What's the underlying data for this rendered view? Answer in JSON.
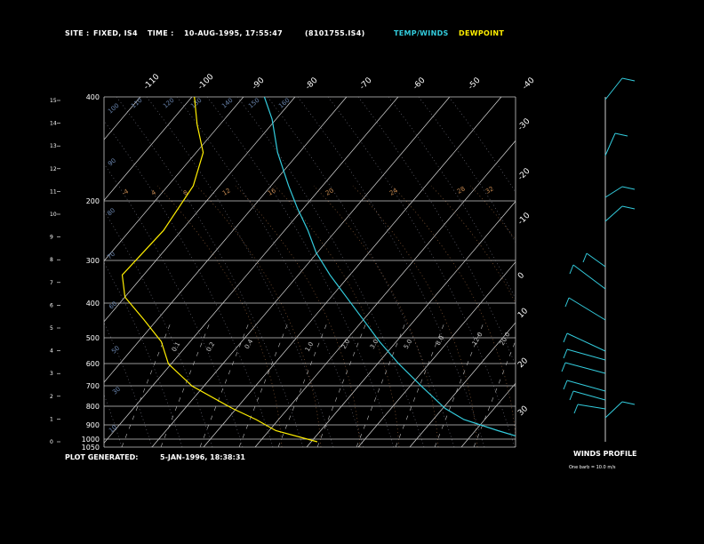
{
  "header": {
    "site_label": "SITE :",
    "site_value": "FIXED, IS4",
    "time_label": "TIME :",
    "time_value": "10-AUG-1995, 17:55:47",
    "file_name": "(8101755.IS4)",
    "temp_winds_label": "TEMP/WINDS",
    "dewpoint_label": "DEWPOINT",
    "colors": {
      "temp": "#33ccdd",
      "dewpoint": "#ffee00"
    }
  },
  "footer": {
    "generated_label": "PLOT GENERATED:",
    "generated_value": "5-JAN-1996, 18:38:31",
    "winds_profile_label": "WINDS PROFILE",
    "barb_note": "One barb = 10.0 m/s"
  },
  "chart_data": {
    "type": "line",
    "chart_kind": "skew-T log-P diagram",
    "x_axis": "temperature (C), skewed",
    "y_axis": "pressure (mb), log scale",
    "pressure_levels": [
      400,
      200,
      300,
      400,
      500,
      600,
      700,
      800,
      900,
      1000,
      1050
    ],
    "pressure_labels": [
      "400",
      "200",
      "300",
      "400",
      "500",
      "600",
      "700",
      "800",
      "900",
      "1000",
      "1050"
    ],
    "height_ticks": [
      "15",
      "14",
      "13",
      "12",
      "11",
      "10",
      "9",
      "8",
      "7",
      "6",
      "5",
      "4",
      "3",
      "2",
      "1",
      "0"
    ],
    "isotherm_top_labels": [
      "-110",
      "-100",
      "-90",
      "-80",
      "-70",
      "-60",
      "-50",
      "-40"
    ],
    "isotherm_right_labels": [
      "-30",
      "-20",
      "-10",
      "0",
      "10",
      "20",
      "30"
    ],
    "dry_adiabat_labels": [
      "10",
      "30",
      "50",
      "60",
      "70",
      "80",
      "90",
      "100",
      "110",
      "120",
      "130",
      "140",
      "150",
      "160"
    ],
    "mixing_ratio_labels": [
      "0.1",
      "0.2",
      "0.4",
      "1.0",
      "2.0",
      "3.0",
      "5.0",
      "8.0",
      "12.0",
      "20.0"
    ],
    "moist_adiabat_labels": [
      "-4",
      "4",
      "8",
      "12",
      "16",
      "20",
      "24",
      "28",
      "32"
    ],
    "series": [
      {
        "name": "TEMP/WINDS",
        "color": "#33ccdd",
        "points": [
          [
            400,
            -80.9
          ],
          [
            440,
            -79.5
          ],
          [
            500,
            -78.5
          ],
          [
            560,
            -76.5
          ],
          [
            600,
            -74.9
          ],
          [
            640,
            -73.0
          ],
          [
            680,
            -71.5
          ],
          [
            720,
            -69.0
          ],
          [
            760,
            -66.0
          ],
          [
            800,
            -63.0
          ],
          [
            840,
            -60.0
          ],
          [
            880,
            -56.5
          ],
          [
            920,
            -52.4
          ],
          [
            960,
            -48.1
          ],
          [
            980,
            -44.7
          ],
          [
            1000,
            -38.5
          ],
          [
            1020,
            -31.8
          ]
        ]
      },
      {
        "name": "DEWPOINT",
        "color": "#ffee00",
        "points": [
          [
            400,
            -93.6
          ],
          [
            450,
            -93.1
          ],
          [
            500,
            -92.0
          ],
          [
            560,
            -93.8
          ],
          [
            640,
            -99.2
          ],
          [
            720,
            -106.7
          ],
          [
            760,
            -106.2
          ],
          [
            800,
            -102.8
          ],
          [
            840,
            -99.6
          ],
          [
            880,
            -98.3
          ],
          [
            920,
            -94.0
          ],
          [
            960,
            -86.7
          ],
          [
            980,
            -82.4
          ],
          [
            1000,
            -78.8
          ],
          [
            1020,
            -71.3
          ]
        ]
      }
    ],
    "winds_profile_label": "WINDS PROFILE",
    "barb_note": "One barb = 10.0 m/s"
  }
}
